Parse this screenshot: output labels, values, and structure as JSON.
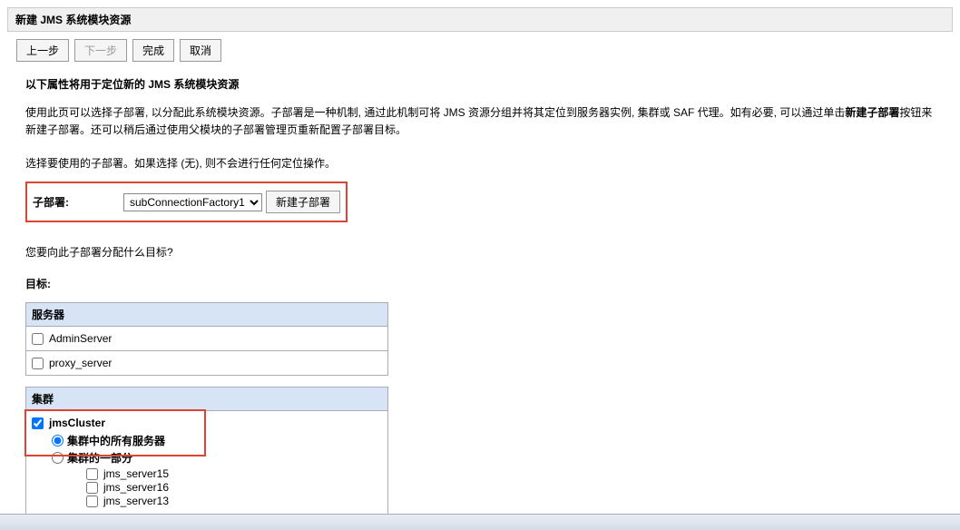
{
  "header": {
    "title": "新建 JMS 系统模块资源"
  },
  "buttons": {
    "prev": "上一步",
    "next": "下一步",
    "finish": "完成",
    "cancel": "取消"
  },
  "section": {
    "title": "以下属性将用于定位新的 JMS 系统模块资源",
    "desc_pre": "使用此页可以选择子部署, 以分配此系统模块资源。子部署是一种机制, 通过此机制可将 JMS 资源分组并将其定位到服务器实例, 集群或 SAF 代理。如有必要, 可以通过单击",
    "desc_bold": "新建子部署",
    "desc_post": "按钮来新建子部署。还可以稍后通过使用父模块的子部署管理页重新配置子部署目标。",
    "instruction": "选择要使用的子部署。如果选择 (无), 则不会进行任何定位操作。"
  },
  "sub": {
    "label": "子部署:",
    "selected": "subConnectionFactory1",
    "create_btn": "新建子部署"
  },
  "question": "您要向此子部署分配什么目标?",
  "targets_label": "目标:",
  "servers": {
    "header": "服务器",
    "items": [
      {
        "name": "AdminServer",
        "checked": false
      },
      {
        "name": "proxy_server",
        "checked": false
      }
    ]
  },
  "clusters": {
    "header": "集群",
    "name": "jmsCluster",
    "checked": true,
    "radio_all": "集群中的所有服务器",
    "radio_part": "集群的一部分",
    "part_servers": [
      {
        "name": "jms_server15",
        "checked": false
      },
      {
        "name": "jms_server16",
        "checked": false
      },
      {
        "name": "jms_server13",
        "checked": false
      }
    ]
  }
}
